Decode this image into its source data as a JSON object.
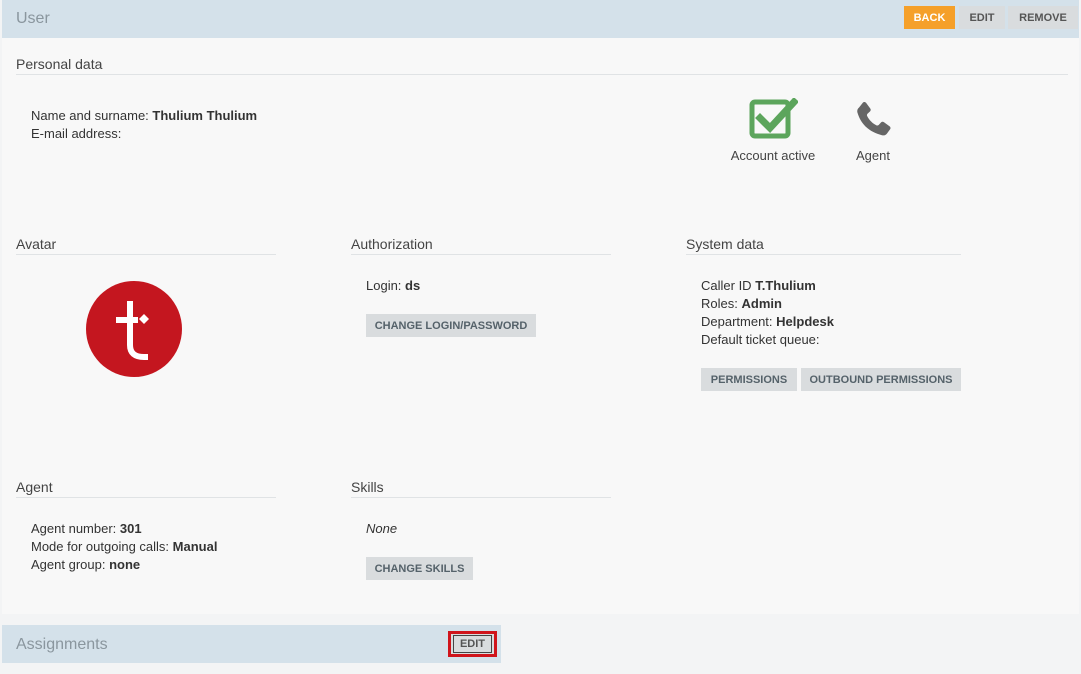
{
  "header": {
    "title": "User",
    "back_label": "BACK",
    "edit_label": "EDIT",
    "remove_label": "REMOVE",
    "accent_color": "#f5a02a"
  },
  "personal": {
    "title": "Personal data",
    "name_label": "Name and surname:",
    "name_value": "Thulium Thulium",
    "email_label": "E-mail address:",
    "email_value": "",
    "account_active_label": "Account active",
    "agent_label": "Agent"
  },
  "avatar": {
    "title": "Avatar",
    "icon": "thulium-logo"
  },
  "authorization": {
    "title": "Authorization",
    "login_label": "Login:",
    "login_value": "ds",
    "change_button": "CHANGE LOGIN/PASSWORD"
  },
  "system": {
    "title": "System data",
    "caller_label": "Caller ID",
    "caller_value": "T.Thulium",
    "roles_label": "Roles:",
    "roles_value": "Admin",
    "department_label": "Department:",
    "department_value": "Helpdesk",
    "queue_label": "Default ticket queue:",
    "permissions_button": "PERMISSIONS",
    "outbound_button": "OUTBOUND PERMISSIONS"
  },
  "agent": {
    "title": "Agent",
    "number_label": "Agent number:",
    "number_value": "301",
    "mode_label": "Mode for outgoing calls:",
    "mode_value": "Manual",
    "group_label": "Agent group:",
    "group_value": "none"
  },
  "skills": {
    "title": "Skills",
    "value": "None",
    "change_button": "CHANGE SKILLS"
  },
  "assignments": {
    "title": "Assignments",
    "edit_label": "EDIT"
  }
}
